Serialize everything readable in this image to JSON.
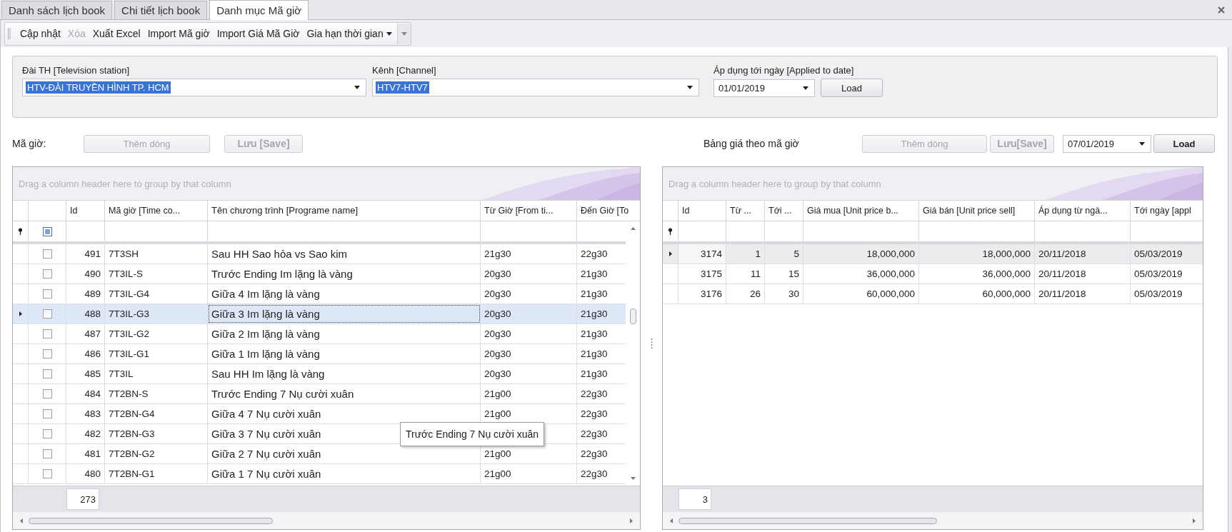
{
  "tabs": [
    {
      "label": "Danh sách lịch book",
      "selected": false
    },
    {
      "label": "Chi tiết lịch book",
      "selected": false
    },
    {
      "label": "Danh mục Mã giờ",
      "selected": true
    }
  ],
  "toolbar": [
    {
      "label": "Cập nhật",
      "disabled": false,
      "has_menu": false
    },
    {
      "label": "Xóa",
      "disabled": true,
      "has_menu": false
    },
    {
      "label": "Xuất Excel",
      "disabled": false,
      "has_menu": false
    },
    {
      "label": "Import Mã giờ",
      "disabled": false,
      "has_menu": false
    },
    {
      "label": "Import Giá Mã Giờ",
      "disabled": false,
      "has_menu": false
    },
    {
      "label": "Gia hạn thời gian",
      "disabled": false,
      "has_menu": true
    }
  ],
  "filters": {
    "station": {
      "label": "Đài TH [Television station]",
      "value": "HTV-ĐÀI TRUYỀN HÌNH TP. HCM"
    },
    "channel": {
      "label": "Kênh [Channel]",
      "value": "HTV7-HTV7"
    },
    "date": {
      "label": "Áp dụng tới ngày [Applied to date]",
      "value": "01/01/2019"
    },
    "load_button": "Load"
  },
  "left": {
    "label": "Mã giờ:",
    "add_button": {
      "label": "Thêm dòng",
      "disabled": true
    },
    "save_button": {
      "label": "Lưu [Save]",
      "disabled": true
    },
    "grid": {
      "group_hint": "Drag a column header here to group by that column",
      "select_all_indeterminate": true,
      "columns": [
        "Id",
        "Mã giờ [Time co...",
        "Tên chương trình [Programe name]",
        "Từ Giờ [From ti...",
        "Đến Giờ [To"
      ],
      "rows": [
        {
          "checked": false,
          "selected": false,
          "cells": [
            "491",
            "7T3SH",
            "Sau HH Sao hỏa vs Sao kim",
            "21g30",
            "22g30"
          ]
        },
        {
          "checked": false,
          "selected": false,
          "cells": [
            "490",
            "7T3IL-S",
            "Trước Ending Im lặng là vàng",
            "20g30",
            "21g30"
          ]
        },
        {
          "checked": false,
          "selected": false,
          "cells": [
            "489",
            "7T3IL-G4",
            "Giữa 4 Im lặng là vàng",
            "20g30",
            "21g30"
          ]
        },
        {
          "checked": false,
          "selected": true,
          "cells": [
            "488",
            "7T3IL-G3",
            "Giữa 3 Im lặng là vàng",
            "20g30",
            "21g30"
          ]
        },
        {
          "checked": false,
          "selected": false,
          "cells": [
            "487",
            "7T3IL-G2",
            "Giữa 2 Im lặng là vàng",
            "20g30",
            "21g30"
          ]
        },
        {
          "checked": false,
          "selected": false,
          "cells": [
            "486",
            "7T3IL-G1",
            "Giữa 1 Im lặng là vàng",
            "20g30",
            "21g30"
          ]
        },
        {
          "checked": false,
          "selected": false,
          "cells": [
            "485",
            "7T3IL",
            "Sau HH Im lặng là vàng",
            "20g30",
            "21g30"
          ]
        },
        {
          "checked": false,
          "selected": false,
          "cells": [
            "484",
            "7T2BN-S",
            "Trước Ending 7 Nụ cười xuân",
            "21g00",
            "22g30"
          ]
        },
        {
          "checked": false,
          "selected": false,
          "cells": [
            "483",
            "7T2BN-G4",
            "Giữa 4 7 Nụ cười xuân",
            "21g00",
            "22g30"
          ]
        },
        {
          "checked": false,
          "selected": false,
          "cells": [
            "482",
            "7T2BN-G3",
            "Giữa 3 7 Nụ cười xuân",
            null,
            "22g30"
          ]
        },
        {
          "checked": false,
          "selected": false,
          "cells": [
            "481",
            "7T2BN-G2",
            "Giữa 2 7 Nụ cười xuân",
            "21g00",
            "22g30"
          ]
        },
        {
          "checked": false,
          "selected": false,
          "cells": [
            "480",
            "7T2BN-G1",
            "Giữa 1 7 Nụ cười xuân",
            "21g00",
            "22g30"
          ]
        }
      ],
      "footer_count": "273"
    }
  },
  "right": {
    "label": "Bảng giá theo mã giờ",
    "add_button": {
      "label": "Thêm dòng",
      "disabled": true
    },
    "save_button": {
      "label": "Lưu[Save]",
      "disabled": true
    },
    "date": "07/01/2019",
    "load_button": "Load",
    "grid": {
      "group_hint": "Drag a column header here to group by that column",
      "columns": [
        "Id",
        "Từ ...",
        "Tới ...",
        "Giá mua [Unit price b...",
        "Giá bán [Unit price sell]",
        "Áp dụng từ ngà...",
        "Tới ngày [appl"
      ],
      "rows": [
        {
          "selected": true,
          "cells": [
            "3174",
            "1",
            "5",
            "18,000,000",
            "18,000,000",
            "20/11/2018",
            "05/03/2019"
          ]
        },
        {
          "selected": false,
          "cells": [
            "3175",
            "11",
            "15",
            "36,000,000",
            "36,000,000",
            "20/11/2018",
            "05/03/2019"
          ]
        },
        {
          "selected": false,
          "cells": [
            "3176",
            "26",
            "30",
            "60,000,000",
            "60,000,000",
            "20/11/2018",
            "05/03/2019"
          ]
        }
      ],
      "footer_count": "3"
    }
  },
  "tooltip": "Trước Ending 7 Nụ cười xuân"
}
